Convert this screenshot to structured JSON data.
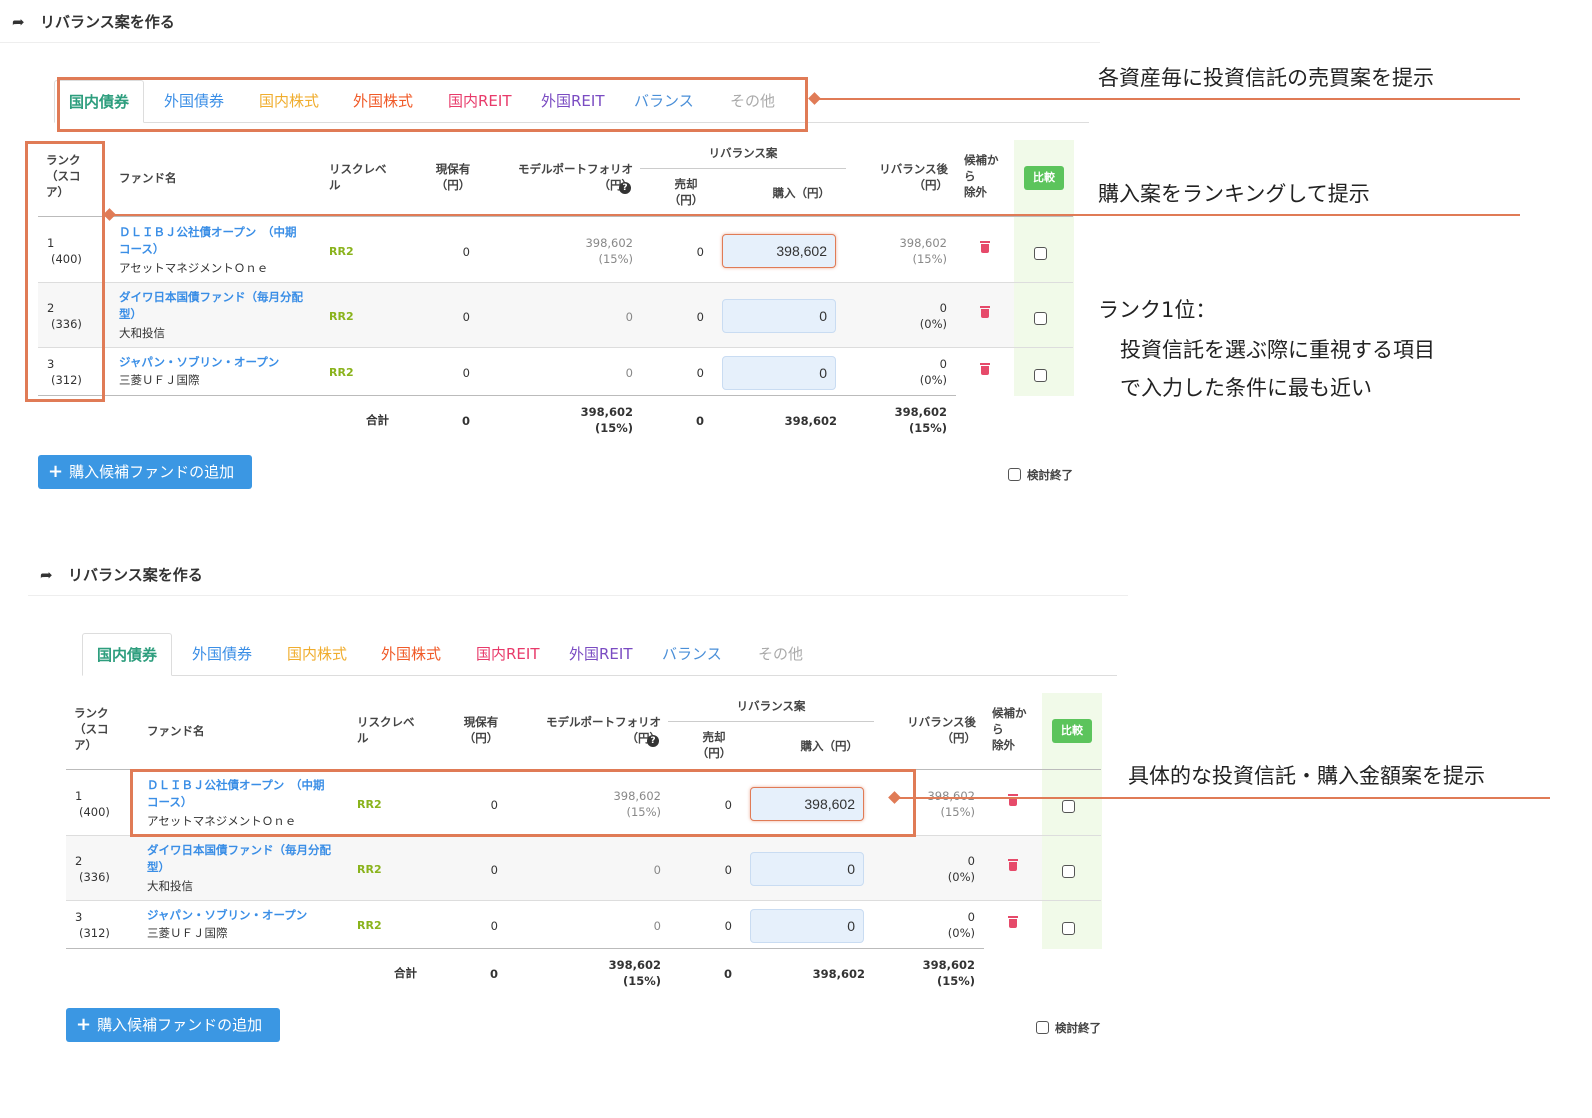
{
  "panel_title": "リバランス案を作る",
  "tabs": [
    {
      "label": "国内債券",
      "color": "#2e9e7e"
    },
    {
      "label": "外国債券",
      "color": "#3a8ee6"
    },
    {
      "label": "国内株式",
      "color": "#f0ad2e"
    },
    {
      "label": "外国株式",
      "color": "#f05a28"
    },
    {
      "label": "国内REIT",
      "color": "#e83a6a"
    },
    {
      "label": "外国REIT",
      "color": "#7a4bc2"
    },
    {
      "label": "バランス",
      "color": "#4a8fd8"
    },
    {
      "label": "その他",
      "color": "#aaaaaa"
    }
  ],
  "table": {
    "headers": {
      "rank": "ランク\n（スコ\nア）",
      "fund": "ファンド名",
      "risk": "リスクレベ\nル",
      "holding": "現保有\n（円）",
      "model": "モデルポートフォリオ\n（円）",
      "rebalance": "リバランス案",
      "sell": "売却\n（円）",
      "buy": "購入（円）",
      "after": "リバランス後\n（円）",
      "exclude": "候補か\nら\n除外",
      "compare": "比較"
    },
    "rows": [
      {
        "rank": "1",
        "score": "(400)",
        "fund_name": "ＤＬＩＢＪ公社債オープン　（中期\nコース）",
        "company": "アセットマネジメントＯｎｅ",
        "risk": "RR2",
        "holding": "0",
        "model": "398,602",
        "model_pct": "(15%)",
        "sell": "0",
        "buy": "398,602",
        "after": "398,602",
        "after_pct": "(15%)"
      },
      {
        "rank": "2",
        "score": "(336)",
        "fund_name": "ダイワ日本国債ファンド（毎月分配\n型）",
        "company": "大和投信",
        "risk": "RR2",
        "holding": "0",
        "model": "0",
        "model_pct": "",
        "sell": "0",
        "buy": "0",
        "after": "0",
        "after_pct": "(0%)"
      },
      {
        "rank": "3",
        "score": "(312)",
        "fund_name": "ジャパン・ソブリン・オープン",
        "company": "三菱ＵＦＪ国際",
        "risk": "RR2",
        "holding": "0",
        "model": "0",
        "model_pct": "",
        "sell": "0",
        "buy": "0",
        "after": "0",
        "after_pct": "(0%)"
      }
    ],
    "total": {
      "label": "合計",
      "holding": "0",
      "model": "398,602",
      "model_pct": "(15%)",
      "sell": "0",
      "buy": "398,602",
      "after": "398,602",
      "after_pct": "(15%)"
    }
  },
  "add_button": "購入候補ファンドの追加",
  "done_label": "検討終了",
  "annotations": {
    "tabs": "各資産毎に投資信託の売買案を提示",
    "ranking": "購入案をランキングして提示",
    "rank1_a": "ランク1位：",
    "rank1_b": "投資信託を選ぶ際に重視する項目",
    "rank1_c": "で入力した条件に最も近い",
    "purchase": "具体的な投資信託・購入金額案を提示"
  },
  "accent_color": "#e07b56"
}
